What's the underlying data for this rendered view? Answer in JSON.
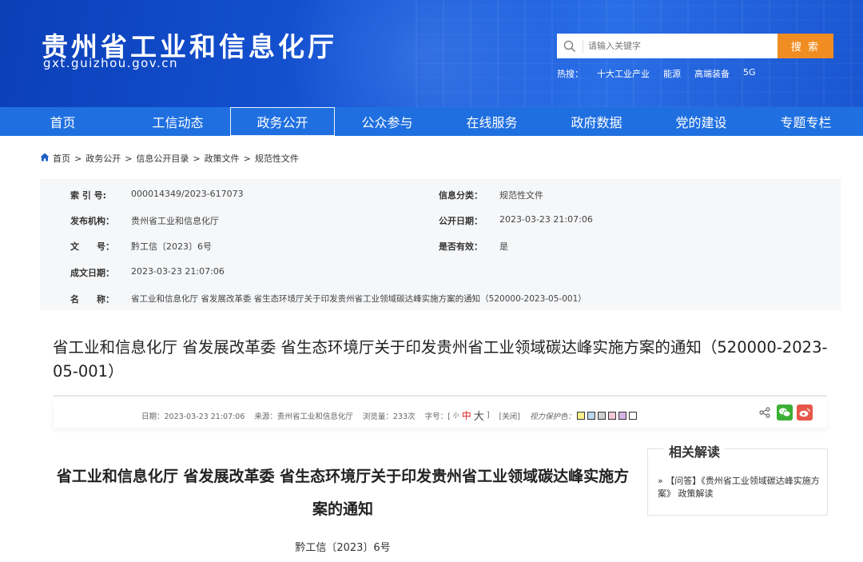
{
  "header": {
    "site_title": "贵州省工业和信息化厅",
    "site_domain": "gxt.guizhou.gov.cn",
    "search_placeholder": "请输入关键字",
    "search_button": "搜 索",
    "hotwords_label": "热搜：",
    "hotwords": [
      "十大工业产业",
      "能源",
      "高端装备",
      "5G"
    ]
  },
  "nav": {
    "items": [
      "首页",
      "工信动态",
      "政务公开",
      "公众参与",
      "在线服务",
      "政府数据",
      "党的建设",
      "专题专栏"
    ],
    "active_index": 2
  },
  "breadcrumb": [
    "首页",
    "政务公开",
    "信息公开目录",
    "政策文件",
    "规范性文件"
  ],
  "info": {
    "index_label": "索 引 号:",
    "index_value": "000014349/2023-617073",
    "category_label": "信息分类：",
    "category_value": "规范性文件",
    "publisher_label": "发布机构：",
    "publisher_value": "贵州省工业和信息化厅",
    "pubdate_label": "公开日期：",
    "pubdate_value": "2023-03-23 21:07:06",
    "docno_label": "文　　号：",
    "docno_value": "黔工信〔2023〕6号",
    "valid_label": "是否有效：",
    "valid_value": "是",
    "created_label": "成文日期：",
    "created_value": "2023-03-23 21:07:06",
    "name_label": "名　　称：",
    "name_value": "省工业和信息化厅 省发展改革委 省生态环境厅关于印发贵州省工业领域碳达峰实施方案的通知（520000-2023-05-001）"
  },
  "article": {
    "title": "省工业和信息化厅 省发展改革委 省生态环境厅关于印发贵州省工业领域碳达峰实施方案的通知（520000-2023-05-001）",
    "meta": {
      "date": "日期：2023-03-23 21:07:06",
      "source": "来源：贵州省工业和信息化厅",
      "views": "浏览量：233次",
      "font_label": "字号：[",
      "font_small": "小",
      "font_mid": "中",
      "font_big": "大",
      "font_end": "]",
      "close": "[关闭]",
      "vision": "视力保护色：",
      "swatch_colors": [
        "#fbf28a",
        "#b9d8ee",
        "#cfcfcf",
        "#f3c9d3",
        "#d6b5e6",
        "#ffffff"
      ]
    },
    "doc_title": "省工业和信息化厅 省发展改革委 省生态环境厅关于印发贵州省工业领域碳达峰实施方案的通知",
    "doc_no": "黔工信〔2023〕6号"
  },
  "related": {
    "title": "相关解读",
    "item": "» 【问答】《贵州省工业领域碳达峰实施方案》 政策解读"
  }
}
